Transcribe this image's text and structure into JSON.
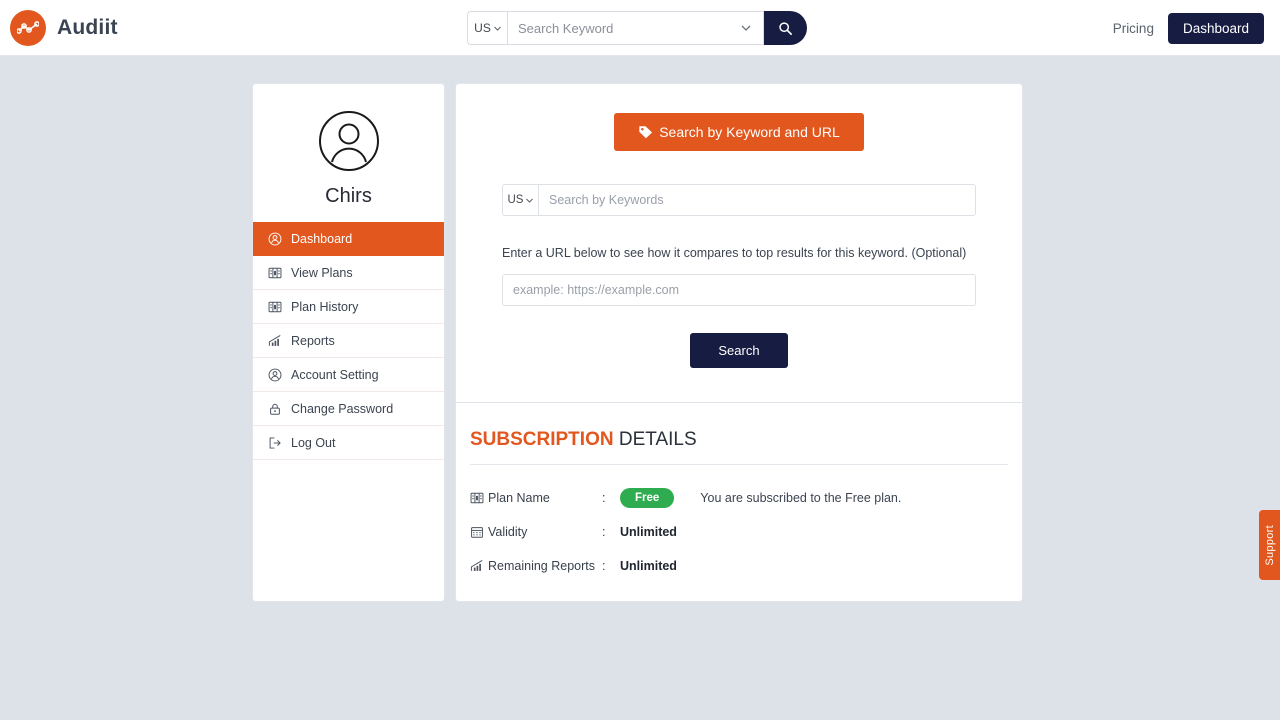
{
  "header": {
    "brand_name": "Audiit",
    "brand_logo_icon": "chart-line-dots-icon",
    "search": {
      "country": "US",
      "country_caret_icon": "chevron-down-icon",
      "keyword_placeholder": "Search Keyword",
      "dropdown_icon": "chevron-down-icon",
      "search_icon": "magnifier-icon"
    },
    "pricing_label": "Pricing",
    "dashboard_label": "Dashboard"
  },
  "sidebar": {
    "avatar_icon": "user-circle-icon",
    "user_name": "Chirs",
    "items": [
      {
        "label": "Dashboard",
        "icon": "user-circle-icon",
        "active": true
      },
      {
        "label": "View Plans",
        "icon": "grid-plans-icon",
        "active": false
      },
      {
        "label": "Plan History",
        "icon": "grid-plans-icon",
        "active": false
      },
      {
        "label": "Reports",
        "icon": "bar-chart-icon",
        "active": false
      },
      {
        "label": "Account Setting",
        "icon": "user-circle-icon",
        "active": false
      },
      {
        "label": "Change Password",
        "icon": "lock-icon",
        "active": false
      },
      {
        "label": "Log Out",
        "icon": "logout-arrow-icon",
        "active": false
      }
    ]
  },
  "main": {
    "keyword_url_button": {
      "label": "Search by Keyword and URL",
      "icon": "tag-icon"
    },
    "keyword_search": {
      "country": "US",
      "country_caret_icon": "chevron-down-icon",
      "placeholder": "Search by Keywords",
      "value": ""
    },
    "url_note": "Enter a URL below to see how it compares to top results for this keyword. (Optional)",
    "url_input": {
      "placeholder": "example: https://example.com",
      "value": ""
    },
    "search_button_label": "Search"
  },
  "subscription": {
    "title_highlight": "SUBSCRIPTION",
    "title_rest": " DETAILS",
    "rows": [
      {
        "icon": "plan-card-icon",
        "label": "Plan Name",
        "colon": ":",
        "badge": "Free",
        "note": "You are subscribed to the Free plan."
      },
      {
        "icon": "calendar-icon",
        "label": "Validity",
        "colon": ":",
        "value": "Unlimited"
      },
      {
        "icon": "bar-chart-icon",
        "label": "Remaining Reports",
        "colon": ":",
        "value": "Unlimited"
      }
    ]
  },
  "support_tab": {
    "label": "Support"
  },
  "colors": {
    "orange": "#e2571e",
    "navy": "#171c42",
    "green": "#2fac4f",
    "page_bg": "#dde2e9"
  }
}
